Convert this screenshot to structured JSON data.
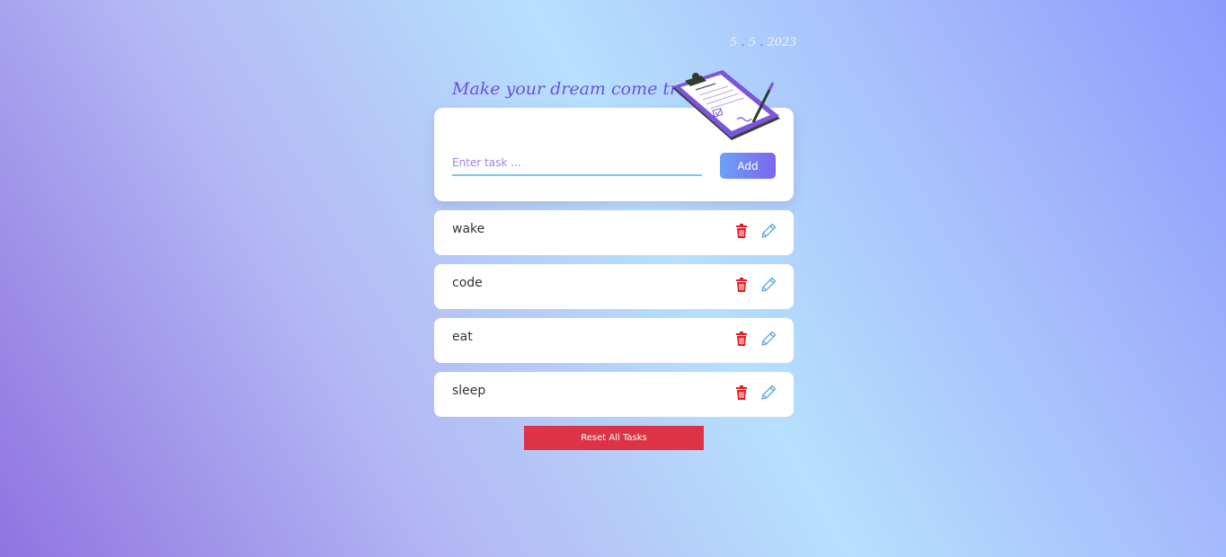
{
  "header": {
    "date": {
      "day": "5",
      "month": "5",
      "year": "2023",
      "separator": "."
    },
    "title": "Make your dream come true",
    "illustration": "clipboard-contract-icon"
  },
  "form": {
    "placeholder": "Enter task ...",
    "value": "",
    "add_label": "Add"
  },
  "tasks": [
    {
      "text": "wake"
    },
    {
      "text": "code"
    },
    {
      "text": "eat"
    },
    {
      "text": "sleep"
    }
  ],
  "icons": {
    "delete": "trash-icon",
    "edit": "pencil-icon"
  },
  "colors": {
    "title": "#6b50df",
    "delete_icon": "#e01c24",
    "edit_icon": "#5ca7df",
    "reset_button": "#dc3446",
    "input_underline": "#7cc6ec"
  },
  "footer": {
    "reset_label": "Reset All Tasks"
  }
}
